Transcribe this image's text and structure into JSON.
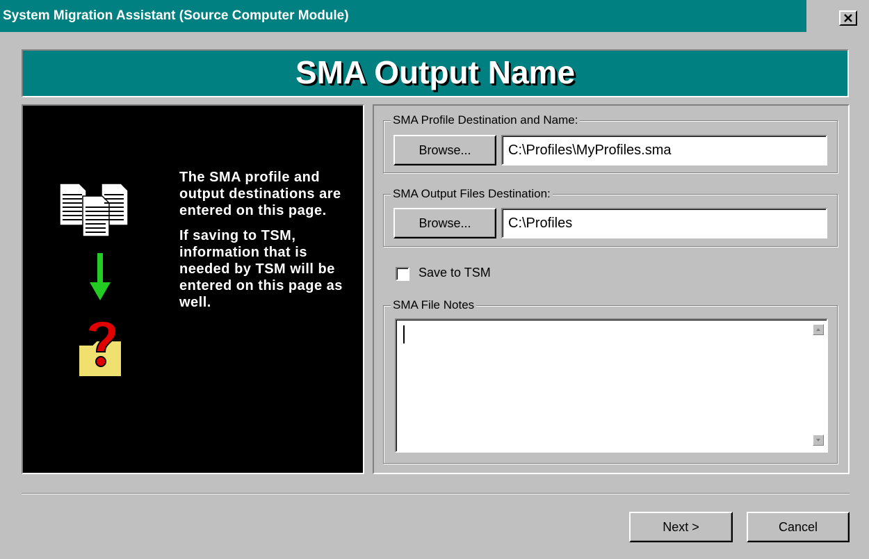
{
  "window": {
    "title": "System Migration Assistant (Source Computer Module)",
    "close_glyph": "✕"
  },
  "banner": {
    "title": "SMA Output Name"
  },
  "info": {
    "paragraph1": "The SMA profile and output destinations are entered on this page.",
    "paragraph2": "If saving to TSM, information that is needed by TSM will be entered on this page as well."
  },
  "icons": [
    "documents-icon",
    "arrow-down-icon",
    "question-folder-icon"
  ],
  "colors": {
    "teal": "#008080",
    "face": "#c0c0c0",
    "arrow": "#22cc22",
    "question": "#e00000",
    "folder": "#f0e070"
  },
  "profile_group": {
    "label": "SMA Profile Destination and Name:",
    "browse_label": "Browse...",
    "value": "C:\\Profiles\\MyProfiles.sma"
  },
  "output_group": {
    "label": "SMA Output Files Destination:",
    "browse_label": "Browse...",
    "value": "C:\\Profiles"
  },
  "save_tsm": {
    "label": "Save to TSM",
    "checked": false
  },
  "notes_group": {
    "label": "SMA File Notes",
    "value": ""
  },
  "footer": {
    "next_label": "Next >",
    "cancel_label": "Cancel"
  }
}
